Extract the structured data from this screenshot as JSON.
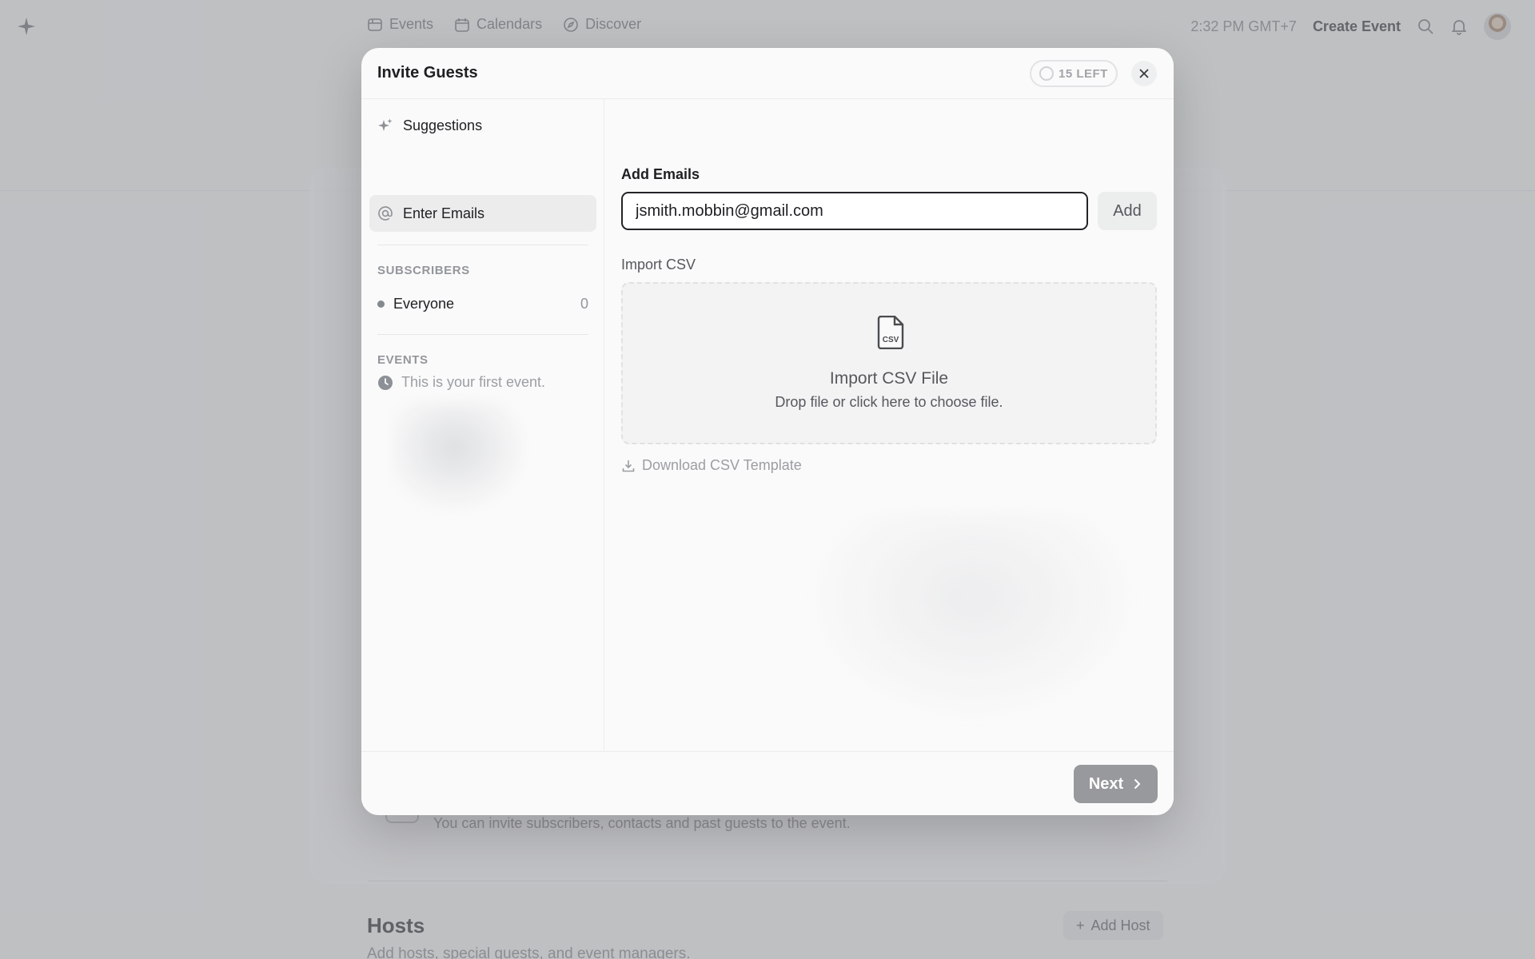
{
  "nav": {
    "links": [
      {
        "label": "Events",
        "icon": "events-icon"
      },
      {
        "label": "Calendars",
        "icon": "calendar-icon"
      },
      {
        "label": "Discover",
        "icon": "discover-icon"
      }
    ],
    "time": "2:32 PM GMT+7",
    "create_event": "Create Event"
  },
  "background": {
    "invite_hint": "You can invite subscribers, contacts and past guests to the event.",
    "hosts_title": "Hosts",
    "hosts_subtitle": "Add hosts, special guests, and event managers.",
    "add_host": "Add Host"
  },
  "modal": {
    "title": "Invite Guests",
    "badge": "15 LEFT",
    "sidebar": {
      "items": [
        {
          "label": "Suggestions",
          "icon": "sparkle-icon",
          "active": false
        },
        {
          "label": "Enter Emails",
          "icon": "at-icon",
          "active": true
        }
      ],
      "subscribers_heading": "SUBSCRIBERS",
      "subscribers": [
        {
          "name": "Everyone",
          "count": "0"
        }
      ],
      "events_heading": "EVENTS",
      "events_empty": "This is your first event."
    },
    "main": {
      "add_emails_label": "Add Emails",
      "email_value": "jsmith.mobbin@gmail.com",
      "add_button": "Add",
      "import_csv_label": "Import CSV",
      "drop_title": "Import CSV File",
      "drop_subtitle": "Drop file or click here to choose file.",
      "csv_icon_text": "CSV",
      "download_template": "Download CSV Template"
    },
    "footer": {
      "next_button": "Next"
    }
  },
  "colors": {
    "accent_dark": "#232427",
    "muted": "#9b9ea3",
    "next_button_bg": "#97999c",
    "overlay": "#6e7176"
  }
}
